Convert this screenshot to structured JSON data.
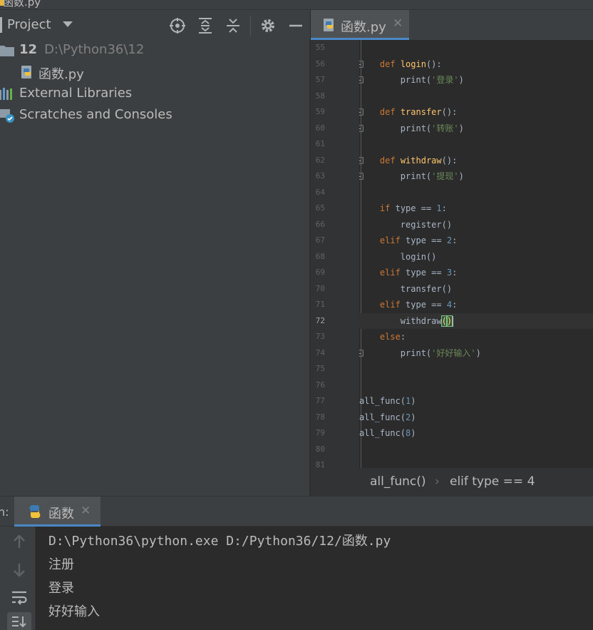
{
  "window": {
    "title_fragment": "函数.py"
  },
  "project": {
    "header_title": "Project",
    "tree": [
      {
        "label": "12",
        "path": "D:\\Python36\\12"
      },
      {
        "label": "函数.py"
      },
      {
        "label": "External Libraries"
      },
      {
        "label": "Scratches and Consoles"
      }
    ]
  },
  "editor": {
    "tab_label": "函数.py",
    "lines": [
      {
        "n": "55",
        "code": ""
      },
      {
        "n": "56",
        "code": "    def login():"
      },
      {
        "n": "57",
        "code": "        print('登录')"
      },
      {
        "n": "58",
        "code": ""
      },
      {
        "n": "59",
        "code": "    def transfer():"
      },
      {
        "n": "60",
        "code": "        print('转账')"
      },
      {
        "n": "61",
        "code": ""
      },
      {
        "n": "62",
        "code": "    def withdraw():"
      },
      {
        "n": "63",
        "code": "        print('提现')"
      },
      {
        "n": "64",
        "code": ""
      },
      {
        "n": "65",
        "code": "    if type == 1:"
      },
      {
        "n": "66",
        "code": "        register()"
      },
      {
        "n": "67",
        "code": "    elif type == 2:"
      },
      {
        "n": "68",
        "code": "        login()"
      },
      {
        "n": "69",
        "code": "    elif type == 3:"
      },
      {
        "n": "70",
        "code": "        transfer()"
      },
      {
        "n": "71",
        "code": "    elif type == 4:"
      },
      {
        "n": "72",
        "code": "        withdraw()"
      },
      {
        "n": "73",
        "code": "    else:"
      },
      {
        "n": "74",
        "code": "        print('好好输入')"
      },
      {
        "n": "75",
        "code": ""
      },
      {
        "n": "76",
        "code": ""
      },
      {
        "n": "77",
        "code": "all_func(1)"
      },
      {
        "n": "78",
        "code": "all_func(2)"
      },
      {
        "n": "79",
        "code": "all_func(8)"
      },
      {
        "n": "80",
        "code": ""
      },
      {
        "n": "81",
        "code": ""
      }
    ],
    "current_line": "72",
    "breadcrumb": [
      "all_func()",
      "elif type == 4"
    ],
    "breadcrumb_sep": "›"
  },
  "run": {
    "prefix": "n:",
    "tab_label": "函数",
    "output": [
      "D:\\Python36\\python.exe D:/Python36/12/函数.py",
      "注册",
      "登录",
      "好好输入"
    ]
  },
  "colors": {
    "keyword": "#cc7832",
    "function": "#ffc66d",
    "string": "#6a8759",
    "number": "#6897bb",
    "accent": "#4a88c7"
  },
  "icons": [
    "locate-icon",
    "expand-all-icon",
    "collapse-all-icon",
    "gear-icon",
    "hide-icon",
    "python-file-icon",
    "folder-icon",
    "libraries-icon",
    "scratches-icon",
    "close-icon",
    "up-arrow-icon",
    "down-arrow-icon",
    "soft-wrap-icon",
    "scroll-to-end-icon"
  ]
}
